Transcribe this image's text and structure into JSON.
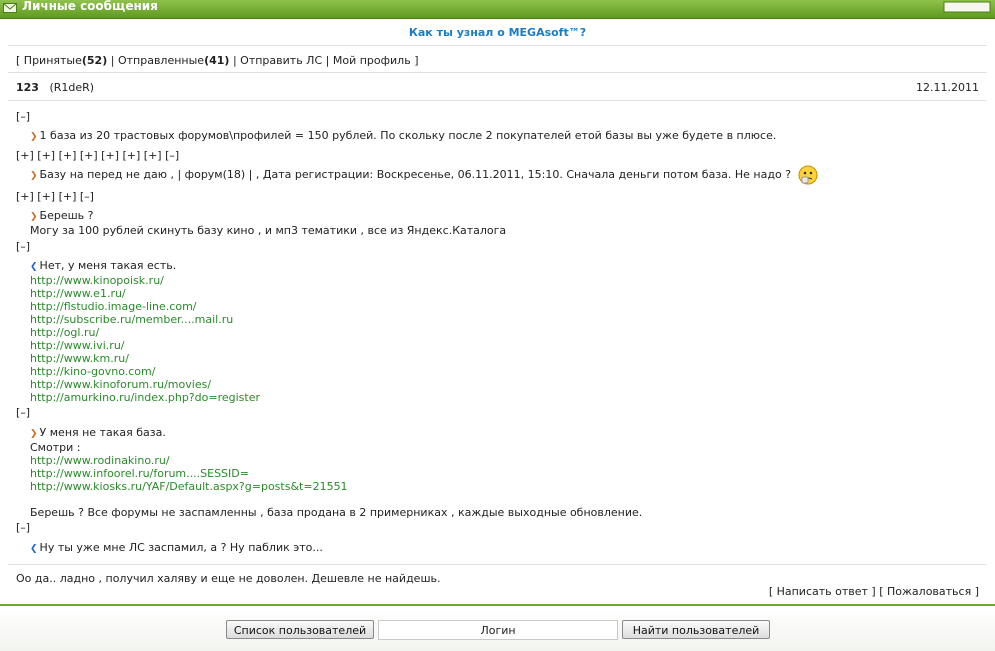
{
  "window": {
    "title": "Личные сообщения"
  },
  "subject": "Как ты узнал о MEGAsoft™?",
  "tabs": {
    "open": "[",
    "received_label": "Принятые",
    "received_count": "(52)",
    "sent_label": "Отправленные",
    "sent_count": "(41)",
    "send": "Отправить ЛС",
    "profile": "Мой профиль",
    "close": "]",
    "sep": "|"
  },
  "message": {
    "number": "123",
    "author": "(R1deR)",
    "date": "12.11.2011"
  },
  "toggles": {
    "t1": "[–]",
    "t2": "[+] [+] [+] [+] [+] [+] [+] [–]",
    "t3": "[+] [+] [+] [–]",
    "t4": "[–]",
    "t5": "[–]",
    "t6": "[–]"
  },
  "quotes": {
    "q1": "1 база из 20 трастовых форумов\\профилей = 150 рублей. По скольку после 2 покупателей етой базы вы уже будете в плюсе.",
    "q2": "Базу на перед не даю , | форум(18) | , Дата регистрации: Воскресенье, 06.11.2011, 15:10. Сначала деньги потом база. Не надо ?",
    "q3_line1": "Берешь ?",
    "q3_line2": "Могу за 100 рублей скинуть базу кино , и мп3 тематики , все из Яндекс.Каталога",
    "q4_line1": "Нет, у меня такая есть.",
    "q4_urls": [
      "http://www.kinopoisk.ru/",
      "http://www.e1.ru/",
      "http://flstudio.image-line.com/",
      "http://subscribe.ru/member....mail.ru",
      "http://ogl.ru/",
      "http://www.ivi.ru/",
      "http://www.km.ru/",
      "http://kino-govno.com/",
      "http://www.kinoforum.ru/movies/",
      "http://amurkino.ru/index.php?do=register"
    ],
    "q5_line1": "У меня не такая база.",
    "q5_line2": "Смотри :",
    "q5_urls": [
      "http://www.rodinakino.ru/",
      "http://www.infoorel.ru/forum....SESSID=",
      "http://www.kiosks.ru/YAF/Default.aspx?g=posts&t=21551"
    ],
    "q5_line3": "Берешь ? Все форумы не заспамленны , база продана в 2 примерниках , каждые выходные обновление.",
    "q6": "Ну ты уже мне ЛС заспамил, а ? Ну паблик это..."
  },
  "reply_text": "Оо да.. ладно , получил халяву и еще не доволен. Дешевле не найдешь.",
  "actions": {
    "reply": "[ Написать ответ ]",
    "complain": "[ Пожаловаться ]"
  },
  "bottom": {
    "user_list": "Список пользователей",
    "login": "Логин",
    "find_users": "Найти пользователей"
  },
  "colors": {
    "accent_green": "#6ea72b",
    "subject_blue": "#1a7dc5",
    "link_green": "#2a8a2a",
    "arrow_orange": "#d36b16"
  }
}
